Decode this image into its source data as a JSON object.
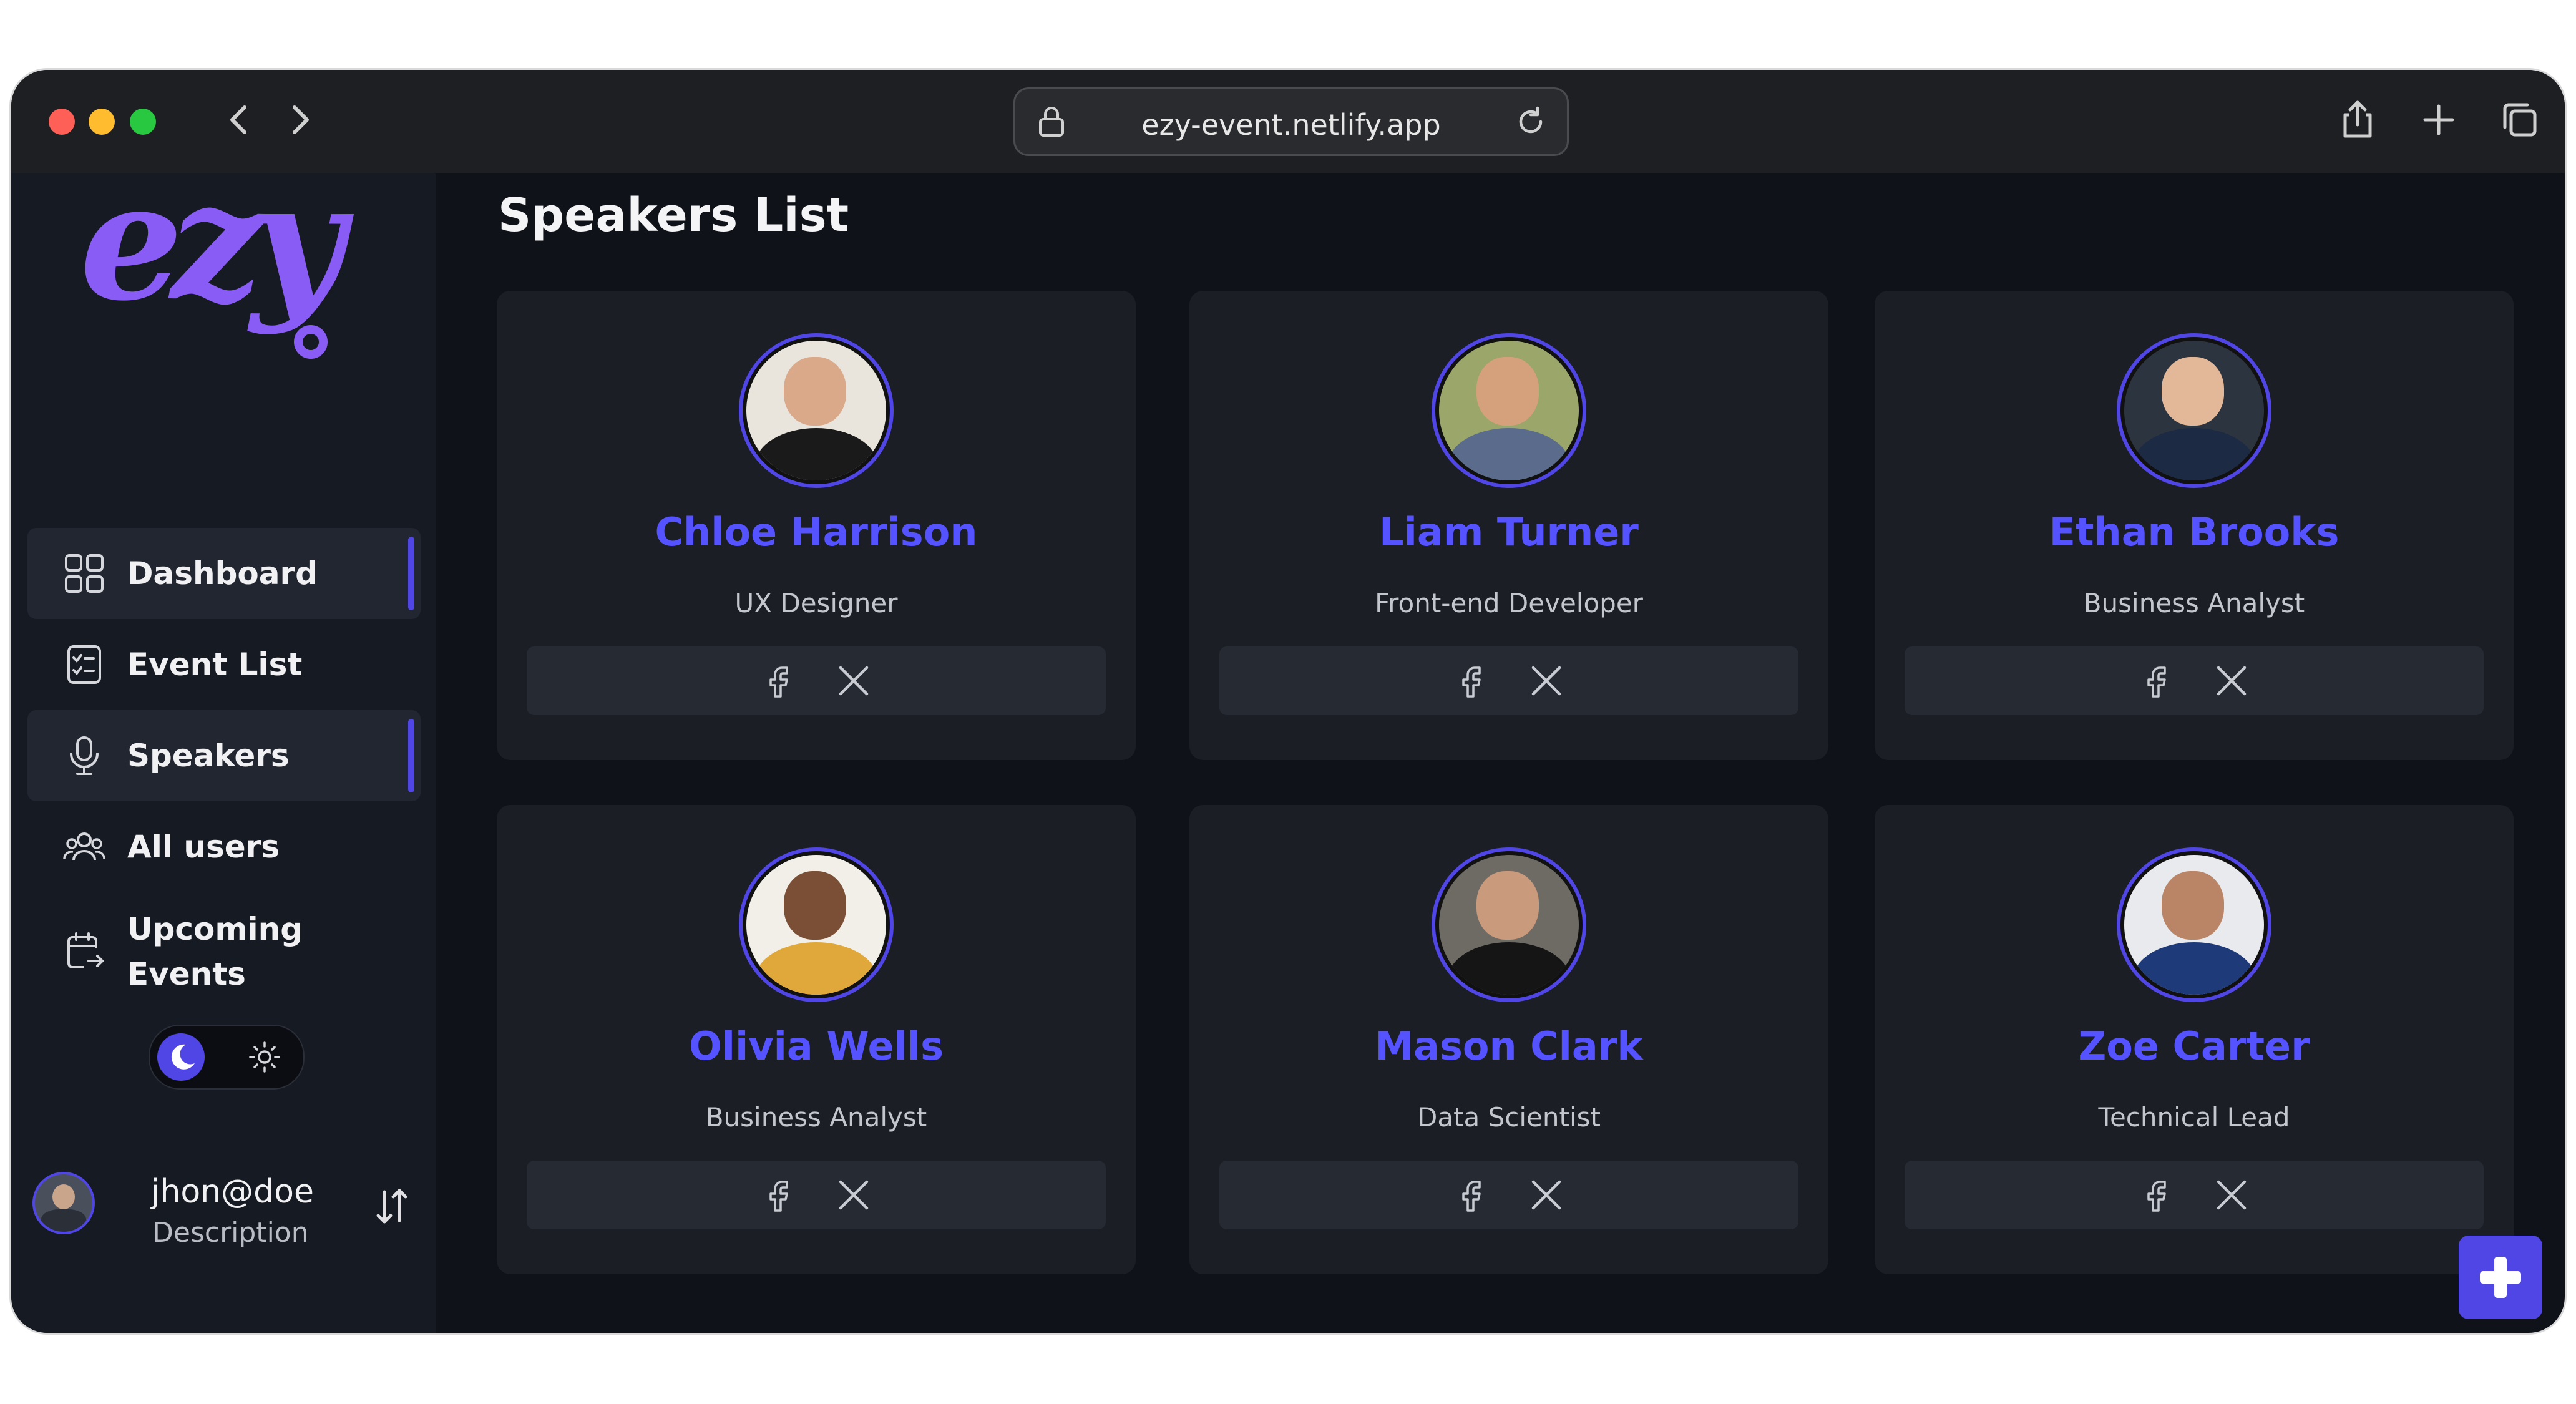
{
  "browser": {
    "url": "ezy-event.netlify.app"
  },
  "sidebar": {
    "logo_text": "ezy",
    "items": [
      {
        "label": "Dashboard",
        "icon": "grid-icon",
        "active": true
      },
      {
        "label": "Event List",
        "icon": "checklist-icon",
        "active": false
      },
      {
        "label": "Speakers",
        "icon": "microphone-icon",
        "active": true
      },
      {
        "label": "All users",
        "icon": "users-icon",
        "active": false
      },
      {
        "label": "Upcoming Events",
        "icon": "calendar-arrow-icon",
        "active": false
      }
    ],
    "theme_toggle": {
      "selected": "dark"
    },
    "user": {
      "name": "jhon@doe",
      "description": "Description"
    }
  },
  "main": {
    "title": "Speakers List",
    "speakers": [
      {
        "name": "Chloe Harrison",
        "role": "UX Designer",
        "bg": "#e9e4dc",
        "skin": "#d9a98a",
        "shirt": "#1a1a1a"
      },
      {
        "name": "Liam Turner",
        "role": "Front-end Developer",
        "bg": "#9aa66a",
        "skin": "#d5a17c",
        "shirt": "#5a6b8c"
      },
      {
        "name": "Ethan Brooks",
        "role": "Business Analyst",
        "bg": "#2c3440",
        "skin": "#e3b899",
        "shirt": "#1d2a44"
      },
      {
        "name": "Olivia Wells",
        "role": "Business Analyst",
        "bg": "#f2efe9",
        "skin": "#7a4f35",
        "shirt": "#e0a83a"
      },
      {
        "name": "Mason Clark",
        "role": "Data Scientist",
        "bg": "#6e6a64",
        "skin": "#c99a7c",
        "shirt": "#151515"
      },
      {
        "name": "Zoe Carter",
        "role": "Technical Lead",
        "bg": "#e8eaee",
        "skin": "#b98566",
        "shirt": "#1e3a78"
      }
    ]
  },
  "colors": {
    "accent": "#4f46e5",
    "speaker_name": "#5552ff",
    "background": "#0f1218",
    "sidebar": "#161a22",
    "card": "#1b1e25"
  }
}
